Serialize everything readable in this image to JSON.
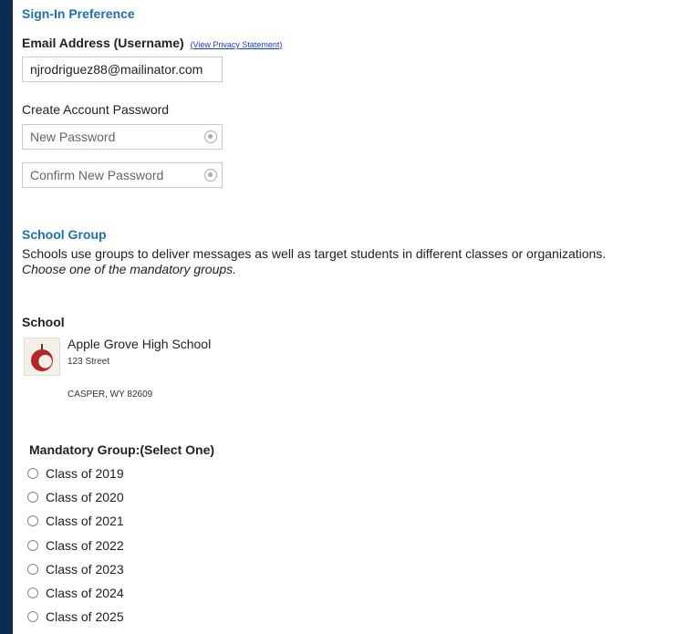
{
  "sign_in": {
    "heading": "Sign-In Preference",
    "email_label": "Email Address (Username)",
    "privacy_link": "(View Privacy Statement)",
    "email_value": "njrodriguez88@mailinator.com",
    "password_label": "Create Account Password",
    "new_password_placeholder": "New Password",
    "confirm_password_placeholder": "Confirm New Password"
  },
  "school_group": {
    "heading": "School Group",
    "description": "Schools use groups to deliver messages as well as target students in different classes or organizations.",
    "instruction": "Choose one of the mandatory groups."
  },
  "school": {
    "label": "School",
    "name": "Apple Grove High School",
    "street": "123 Street",
    "city_state_zip": "CASPER, WY 82609"
  },
  "mandatory_group": {
    "label": "Mandatory Group:(Select One)",
    "options": [
      "Class of 2019",
      "Class of 2020",
      "Class of 2021",
      "Class of 2022",
      "Class of 2023",
      "Class of 2024",
      "Class of 2025"
    ]
  },
  "colors": {
    "page_background": "#0b2c55",
    "heading_blue": "#1f6fb4",
    "link_blue": "#1a3fd6"
  },
  "icons": [
    "reveal-password-icon",
    "school-logo-apple"
  ]
}
